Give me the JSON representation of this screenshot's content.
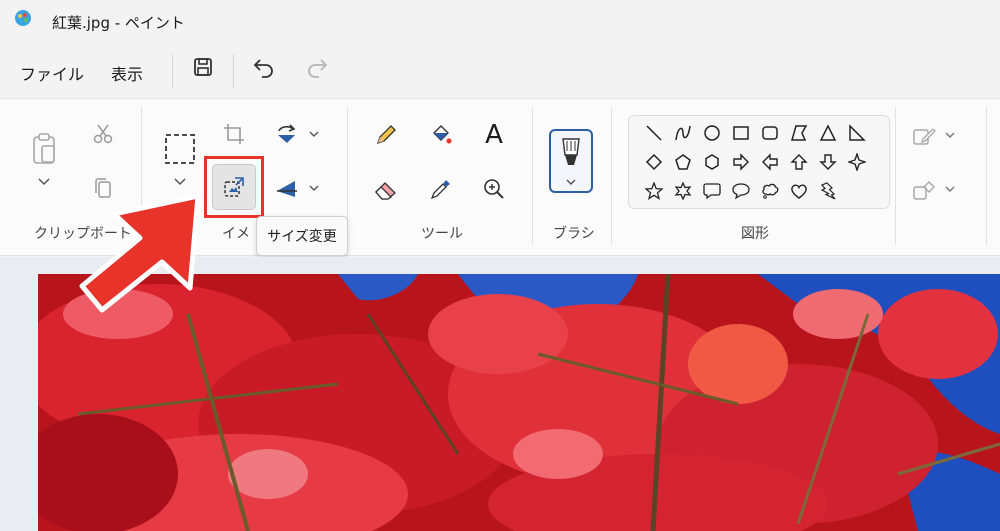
{
  "window": {
    "title": "紅葉.jpg - ペイント"
  },
  "menu": {
    "file": "ファイル",
    "view": "表示"
  },
  "ribbon": {
    "groups": {
      "clipboard": "クリップボード",
      "image": "イメ",
      "tools": "ツール",
      "brushes": "ブラシ",
      "shapes": "図形"
    },
    "text_tool_glyph": "A"
  },
  "tooltip": {
    "text": "サイズ変更"
  },
  "colors": {
    "highlight": "#e8332b",
    "accent": "#2b5fa8",
    "sky": "#1f4fbf"
  }
}
